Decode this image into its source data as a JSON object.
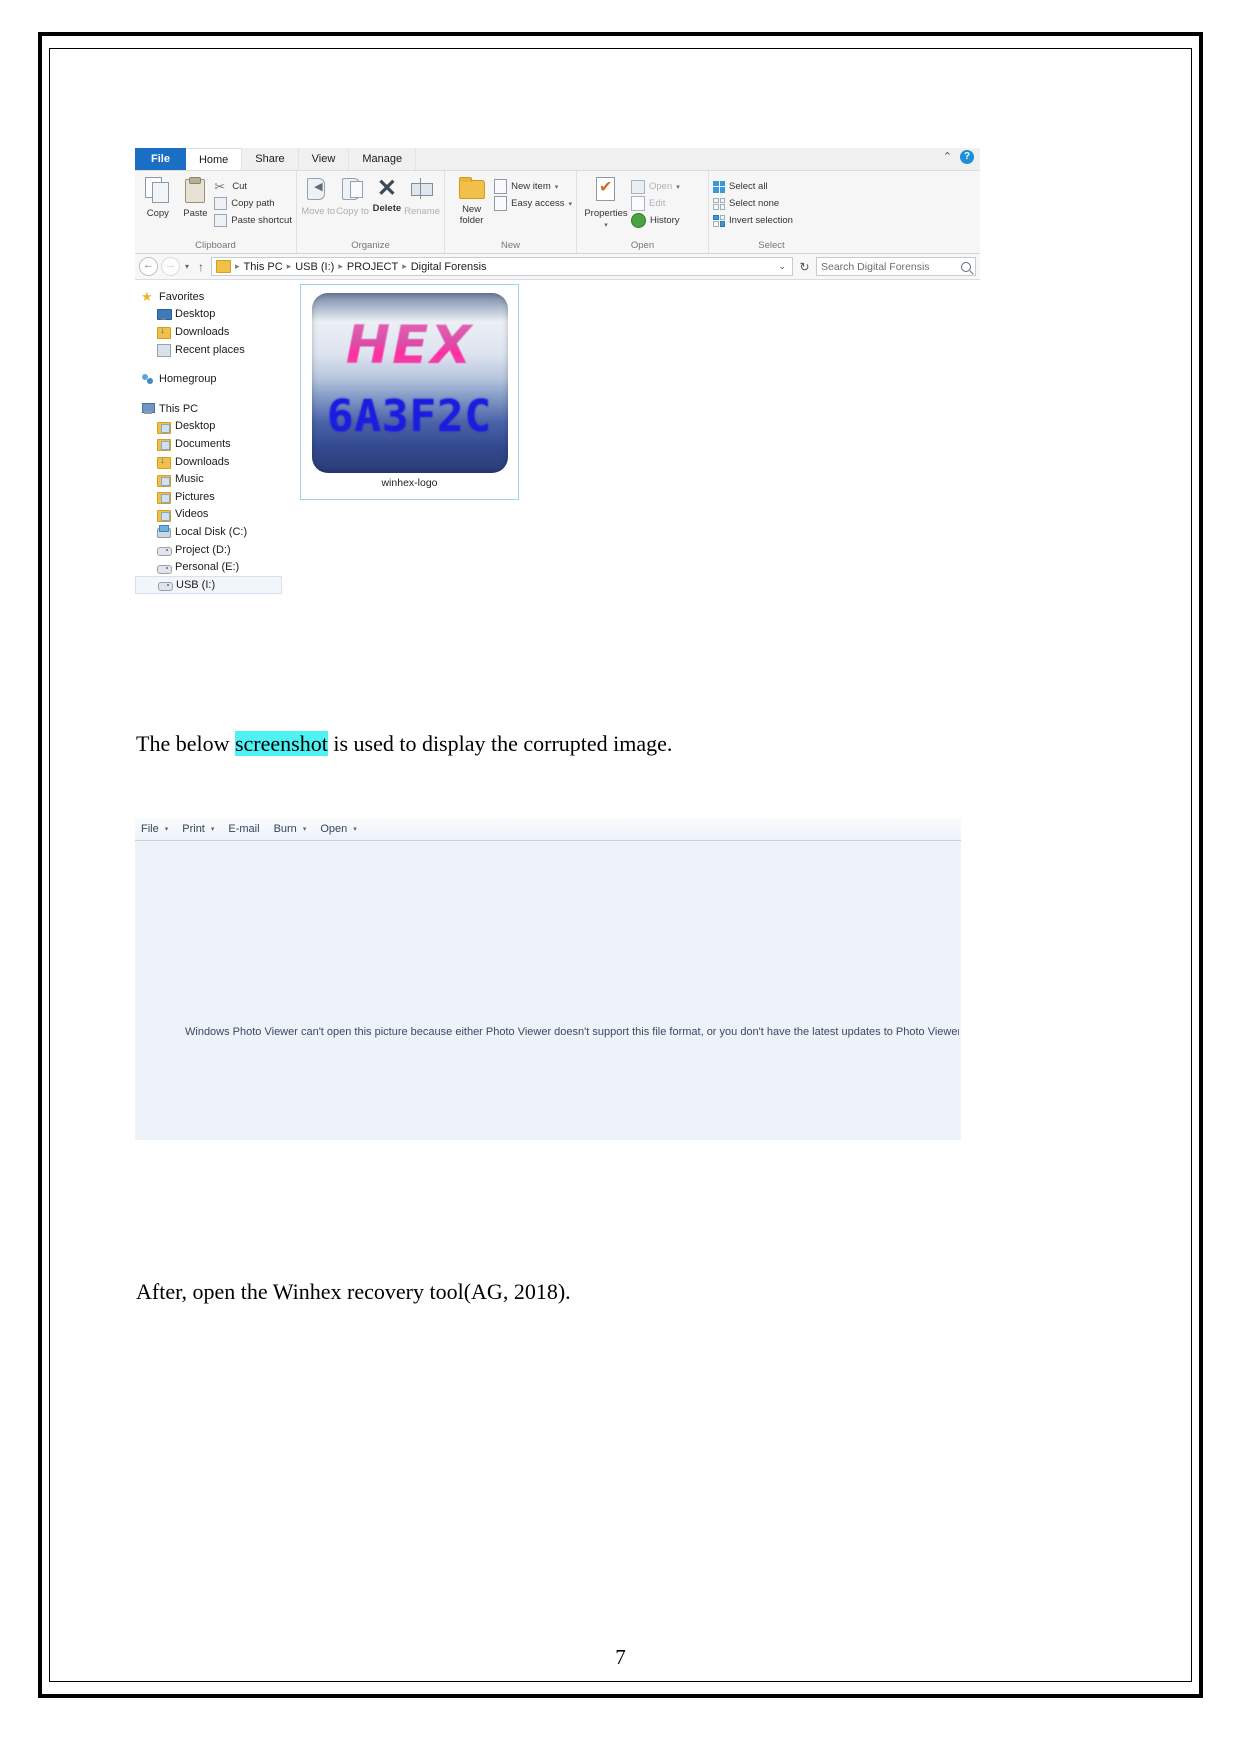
{
  "document": {
    "page_number": "7",
    "paragraph_1_before": "The below ",
    "paragraph_1_highlight": "screenshot",
    "paragraph_1_after": " is used to display the corrupted image.",
    "paragraph_2": "After, open the Winhex recovery tool(AG, 2018)."
  },
  "explorer": {
    "tabs": [
      {
        "label": "File",
        "style": "file"
      },
      {
        "label": "Home",
        "style": "active"
      },
      {
        "label": "Share",
        "style": "normal"
      },
      {
        "label": "View",
        "style": "normal"
      },
      {
        "label": "Manage",
        "style": "normal"
      }
    ],
    "tabbar_right": {
      "collapse_ribbon": "⌃",
      "help": "?"
    },
    "ribbon": {
      "groups": [
        {
          "name": "Clipboard",
          "label": "Clipboard",
          "big": [
            {
              "label": "Copy",
              "icon": "copy-icon",
              "disabled": false
            },
            {
              "label": "Paste",
              "icon": "paste-icon",
              "disabled": false
            }
          ],
          "small": [
            {
              "label": "Cut",
              "icon": "cut-icon",
              "disabled": false
            },
            {
              "label": "Copy path",
              "icon": "copy-path-icon",
              "disabled": false
            },
            {
              "label": "Paste shortcut",
              "icon": "paste-shortcut-icon",
              "disabled": false
            }
          ]
        },
        {
          "name": "Organize",
          "label": "Organize",
          "big": [
            {
              "label": "Move to",
              "icon": "move-to-icon",
              "disabled": true
            },
            {
              "label": "Copy to",
              "icon": "copy-to-icon",
              "disabled": true
            },
            {
              "label": "Delete",
              "icon": "delete-icon",
              "disabled": false
            },
            {
              "label": "Rename",
              "icon": "rename-icon",
              "disabled": true
            }
          ],
          "small": []
        },
        {
          "name": "New",
          "label": "New",
          "big": [
            {
              "label": "New folder",
              "icon": "new-folder-icon",
              "disabled": false
            }
          ],
          "small": [
            {
              "label": "New item",
              "icon": "new-item-icon",
              "disabled": false,
              "dropdown": true
            },
            {
              "label": "Easy access",
              "icon": "easy-access-icon",
              "disabled": false,
              "dropdown": true
            }
          ]
        },
        {
          "name": "Open",
          "label": "Open",
          "big": [
            {
              "label": "Properties",
              "icon": "properties-icon",
              "disabled": false
            }
          ],
          "small": [
            {
              "label": "Open",
              "icon": "open-icon",
              "disabled": true,
              "dropdown": true
            },
            {
              "label": "Edit",
              "icon": "edit-icon",
              "disabled": true
            },
            {
              "label": "History",
              "icon": "history-icon",
              "disabled": false
            }
          ]
        },
        {
          "name": "Select",
          "label": "Select",
          "big": [],
          "small": [
            {
              "label": "Select all",
              "icon": "select-all-icon",
              "disabled": false
            },
            {
              "label": "Select none",
              "icon": "select-none-icon",
              "disabled": false
            },
            {
              "label": "Invert selection",
              "icon": "invert-selection-icon",
              "disabled": false
            }
          ]
        }
      ]
    },
    "address_bar": {
      "back": "←",
      "forward": "→",
      "recent_dropdown": "▾",
      "up": "↑",
      "breadcrumbs": [
        "This PC",
        "USB (I:)",
        "PROJECT",
        "Digital Forensis"
      ],
      "separator": "▸",
      "history_chevron": "⌄",
      "refresh": "↻",
      "search_placeholder": "Search Digital Forensis"
    },
    "nav_pane": [
      {
        "label": "Favorites",
        "icon": "star-icon",
        "indent": false,
        "selected": false
      },
      {
        "label": "Desktop",
        "icon": "desktop-icon",
        "indent": true,
        "selected": false
      },
      {
        "label": "Downloads",
        "icon": "downloads-icon",
        "indent": true,
        "selected": false
      },
      {
        "label": "Recent places",
        "icon": "recent-places-icon",
        "indent": true,
        "selected": false
      },
      {
        "label": "",
        "icon": "gap",
        "indent": false,
        "selected": false
      },
      {
        "label": "Homegroup",
        "icon": "homegroup-icon",
        "indent": false,
        "selected": false
      },
      {
        "label": "",
        "icon": "gap",
        "indent": false,
        "selected": false
      },
      {
        "label": "This PC",
        "icon": "this-pc-icon",
        "indent": false,
        "selected": false
      },
      {
        "label": "Desktop",
        "icon": "folder-icon",
        "indent": true,
        "selected": false
      },
      {
        "label": "Documents",
        "icon": "folder-icon",
        "indent": true,
        "selected": false
      },
      {
        "label": "Downloads",
        "icon": "downloads-icon",
        "indent": true,
        "selected": false
      },
      {
        "label": "Music",
        "icon": "folder-icon",
        "indent": true,
        "selected": false
      },
      {
        "label": "Pictures",
        "icon": "folder-icon",
        "indent": true,
        "selected": false
      },
      {
        "label": "Videos",
        "icon": "folder-icon",
        "indent": true,
        "selected": false
      },
      {
        "label": "Local Disk (C:)",
        "icon": "local-disk-icon",
        "indent": true,
        "selected": false
      },
      {
        "label": "Project (D:)",
        "icon": "drive-icon",
        "indent": true,
        "selected": false
      },
      {
        "label": "Personal (E:)",
        "icon": "drive-icon",
        "indent": true,
        "selected": false
      },
      {
        "label": "USB (I:)",
        "icon": "drive-icon",
        "indent": true,
        "selected": true
      }
    ],
    "file_tile": {
      "name": "winhex-logo",
      "thumbnail_top_text": "HEX",
      "thumbnail_bottom_text": "6A3F2C",
      "thumbnail_top_color": "#e6399b",
      "thumbnail_bottom_color": "#1c1ce0"
    }
  },
  "photo_viewer": {
    "toolbar": [
      {
        "label": "File",
        "dropdown": true
      },
      {
        "label": "Print",
        "dropdown": true
      },
      {
        "label": "E-mail",
        "dropdown": false
      },
      {
        "label": "Burn",
        "dropdown": true
      },
      {
        "label": "Open",
        "dropdown": true
      }
    ],
    "error_message": "Windows Photo Viewer can't open this picture because either Photo Viewer doesn't support this file format, or you don't have the latest updates to Photo Viewer."
  }
}
